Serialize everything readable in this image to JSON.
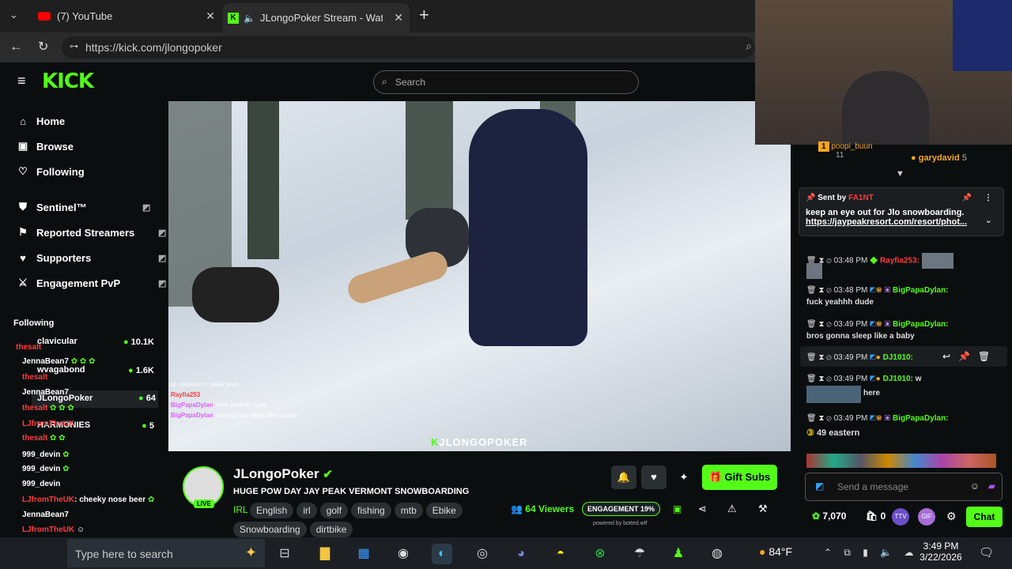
{
  "browser": {
    "tabs": [
      {
        "label": "(7) YouTube"
      },
      {
        "label": "JLongoPoker Stream - Watch"
      }
    ],
    "new_tab": "+",
    "url": "https://kick.com/jlongopoker"
  },
  "site": {
    "logo": "KICK",
    "search_placeholder": "Search"
  },
  "sidebar": {
    "nav": [
      {
        "label": "Home",
        "icon": "home-icon"
      },
      {
        "label": "Browse",
        "icon": "browse-icon"
      },
      {
        "label": "Following",
        "icon": "heart-icon"
      }
    ],
    "mod": [
      {
        "label": "Sentinel™",
        "icon": "shield-icon"
      },
      {
        "label": "Reported Streamers",
        "icon": "flag-icon"
      },
      {
        "label": "Supporters",
        "icon": "heart-icon"
      },
      {
        "label": "Engagement PvP",
        "icon": "swords-icon"
      }
    ],
    "following_title": "Following",
    "following": [
      {
        "name": "clavicular",
        "count": "10.1K"
      },
      {
        "name": "wvagabond",
        "count": "1.6K"
      },
      {
        "name": "JLongoPoker",
        "count": "64"
      },
      {
        "name": "HARMONIES",
        "count": "5"
      }
    ],
    "overlay_chat": [
      {
        "user": "thesalt",
        "text": ""
      },
      {
        "user": "JennaBean7",
        "text": ""
      },
      {
        "user": "thesalt",
        "text": ""
      },
      {
        "user": "JennaBean7",
        "text": ""
      },
      {
        "user": "thesalt",
        "text": ""
      },
      {
        "user": "LJfromTheUK",
        "text": ""
      },
      {
        "user": "thesalt",
        "text": ""
      },
      {
        "user": "999_devin",
        "text": ""
      },
      {
        "user": "999_devin",
        "text": ""
      },
      {
        "user": "999_devin",
        "text": ""
      },
      {
        "user": "LJfromTheUK",
        "text": ": cheeky nose beer"
      },
      {
        "user": "JennaBean7",
        "text": ""
      },
      {
        "user": "LJfromTheUK",
        "text": ""
      },
      {
        "user": "999_devin",
        "text": ""
      },
      {
        "user": "999_devin",
        "text": ""
      }
    ]
  },
  "video": {
    "watermark": "JLONGOPOKER",
    "overlay_chat": [
      {
        "user": "",
        "text": "ur covered in snow lmao"
      },
      {
        "user": "Rayfia253",
        "text": ""
      },
      {
        "user": "BigPapaDylan",
        "text": ": fuck yeahhh dude"
      },
      {
        "user": "BigPapaDylan",
        "text": ": bros gonna sleep like a baby"
      }
    ]
  },
  "channel": {
    "name": "JLongoPoker",
    "live_badge": "LIVE",
    "title": "HUGE POW DAY JAY PEAK VERMONT SNOWBOARDING",
    "category": "IRL",
    "tags": [
      "English",
      "irl",
      "golf",
      "fishing",
      "mtb",
      "Ebike",
      "Snowboarding",
      "dirtbike"
    ],
    "viewers": "64 Viewers",
    "engagement_label": "ENGAGEMENT",
    "engagement_value": "19%",
    "powered_by": "powered by botted.wtf",
    "gift_subs": "Gift Subs"
  },
  "chat": {
    "top_users": [
      {
        "name": "poopi_buun",
        "count": "11"
      },
      {
        "name": "garydavid",
        "count": "5"
      }
    ],
    "pinned": {
      "sent_by": "Sent by",
      "sender": "FA1NT",
      "text": "keep an eye out for Jlo snowboarding.",
      "link": "https://jaypeakresort.com/resort/phot..."
    },
    "messages": [
      {
        "time": "03:48 PM",
        "user": "Rayfia253:",
        "text": ""
      },
      {
        "time": "03:48 PM",
        "user": "BigPapaDylan:",
        "text": "fuck yeahhh dude"
      },
      {
        "time": "03:49 PM",
        "user": "BigPapaDylan:",
        "text": "bros gonna sleep like a baby"
      },
      {
        "time": "03:49 PM",
        "user": "DJ1010:",
        "text": ""
      },
      {
        "time": "03:49 PM",
        "user": "DJ1010:",
        "text": "w"
      },
      {
        "time": "",
        "user": "",
        "text": "here"
      },
      {
        "time": "03:49 PM",
        "user": "BigPapaDylan:",
        "text": ""
      },
      {
        "time": "",
        "user": "",
        "text": "49 eastern"
      }
    ],
    "input_placeholder": "Send a message",
    "points": "7,070",
    "zero": "0",
    "chat_button": "Chat"
  },
  "taskbar": {
    "search_placeholder": "Type here to search",
    "weather": "84°F",
    "time": "3:49 PM",
    "date": "3/22/2026"
  },
  "colors": {
    "kick_green": "#53fc18",
    "bg": "#0b0e0f"
  }
}
